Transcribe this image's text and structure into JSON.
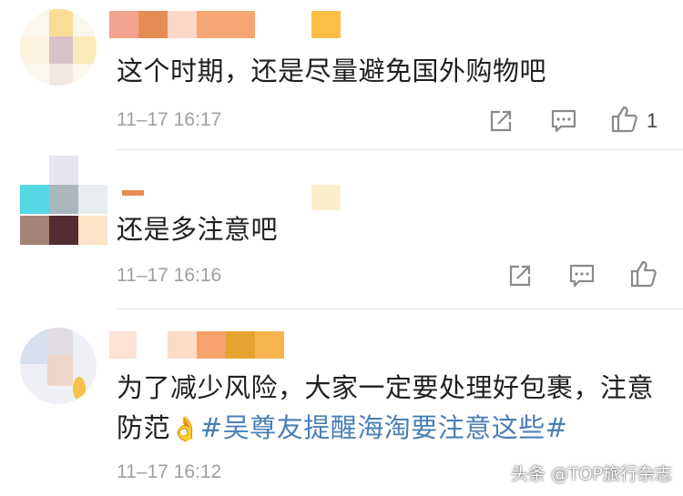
{
  "comments": [
    {
      "text": "这个时期，还是尽量避免国外购物吧",
      "time": "11–17 16:17",
      "like_count": "1"
    },
    {
      "text": "还是多注意吧",
      "time": "11–17 16:16",
      "like_count": ""
    },
    {
      "text_plain": "为了减少风险，大家一定要处理好包裹，注意防范",
      "emoji": "👌",
      "hashtag": "#吴尊友提醒海淘要注意这些#",
      "time": "11–17 16:12"
    }
  ],
  "icons": [
    "share-icon",
    "comment-icon",
    "like-icon"
  ],
  "watermark": "头条 @TOP旅行杂志",
  "colors": {
    "text": "#1f1f1f",
    "time": "#a0a0a0",
    "hashtag": "#4a7fb5",
    "icon": "#8a8a8a",
    "divider": "#e6e6e6"
  }
}
